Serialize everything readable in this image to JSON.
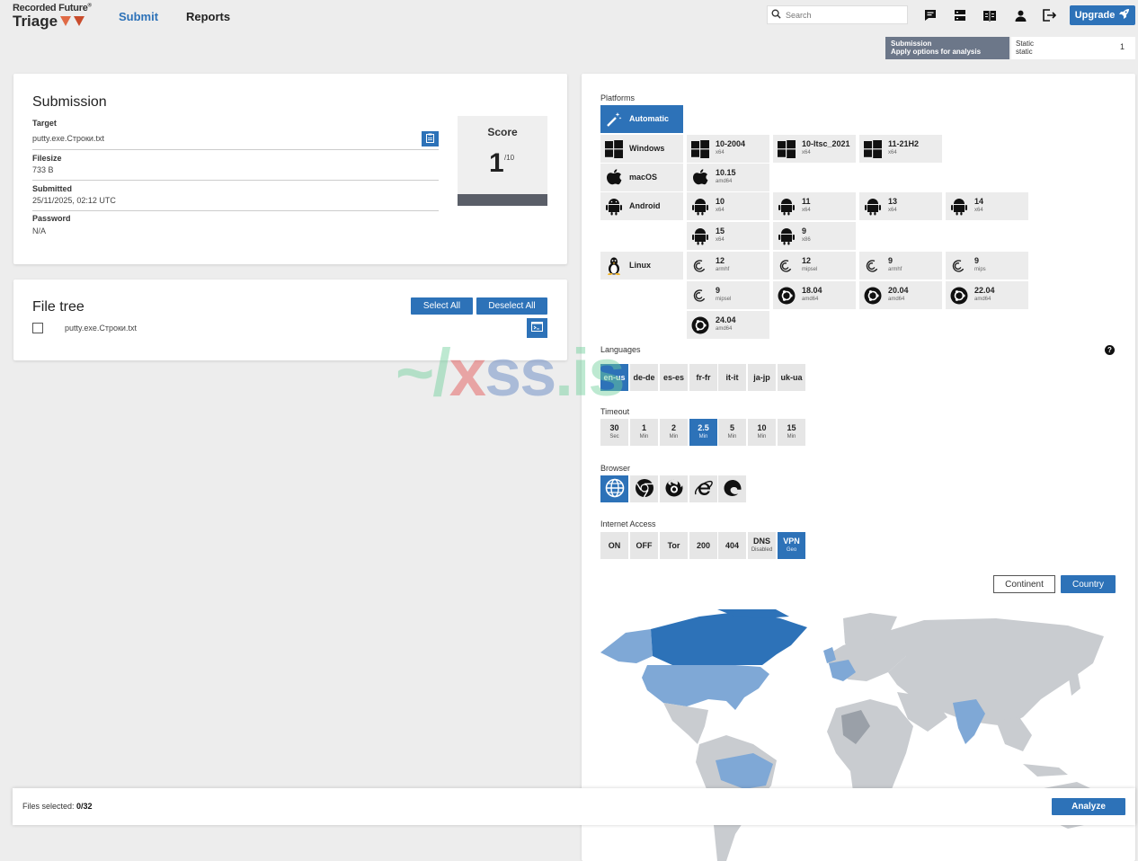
{
  "brand": {
    "company": "Recorded Future",
    "product": "Triage"
  },
  "nav": {
    "submit": "Submit",
    "reports": "Reports"
  },
  "search": {
    "placeholder": "Search"
  },
  "upgrade": {
    "label": "Upgrade"
  },
  "badge": {
    "line1": "Submission",
    "line2": "Apply options for analysis"
  },
  "static_box": {
    "line1": "Static",
    "line2": "static",
    "count": "1"
  },
  "submission": {
    "title": "Submission",
    "target_label": "Target",
    "target": "putty.exe.Строки.txt",
    "filesize_label": "Filesize",
    "filesize": "733 B",
    "submitted_label": "Submitted",
    "submitted": "25/11/2025, 02:12 UTC",
    "password_label": "Password",
    "password": "N/A",
    "score_label": "Score",
    "score": "1",
    "score_max": "/10"
  },
  "file_tree": {
    "title": "File tree",
    "select_all": "Select All",
    "deselect_all": "Deselect All",
    "file": "putty.exe.Строки.txt"
  },
  "platforms": {
    "label": "Platforms",
    "automatic": "Automatic",
    "windows": {
      "name": "Windows",
      "versions": [
        {
          "name": "10-2004",
          "arch": "x64"
        },
        {
          "name": "10-ltsc_2021",
          "arch": "x64"
        },
        {
          "name": "11-21H2",
          "arch": "x64"
        }
      ]
    },
    "macos": {
      "name": "macOS",
      "versions": [
        {
          "name": "10.15",
          "arch": "amd64"
        }
      ]
    },
    "android": {
      "name": "Android",
      "versions": [
        {
          "name": "10",
          "arch": "x64"
        },
        {
          "name": "11",
          "arch": "x64"
        },
        {
          "name": "13",
          "arch": "x64"
        },
        {
          "name": "14",
          "arch": "x64"
        },
        {
          "name": "15",
          "arch": "x64"
        },
        {
          "name": "9",
          "arch": "x86"
        }
      ]
    },
    "linux": {
      "name": "Linux",
      "versions": [
        {
          "name": "12",
          "arch": "armhf"
        },
        {
          "name": "12",
          "arch": "mipsel"
        },
        {
          "name": "9",
          "arch": "armhf"
        },
        {
          "name": "9",
          "arch": "mips"
        },
        {
          "name": "9",
          "arch": "mipsel"
        },
        {
          "name": "18.04",
          "arch": "amd64"
        },
        {
          "name": "20.04",
          "arch": "amd64"
        },
        {
          "name": "22.04",
          "arch": "amd64"
        },
        {
          "name": "24.04",
          "arch": "amd64"
        }
      ]
    }
  },
  "languages": {
    "label": "Languages",
    "options": [
      "en-us",
      "de-de",
      "es-es",
      "fr-fr",
      "it-it",
      "ja-jp",
      "uk-ua"
    ],
    "selected": "en-us"
  },
  "timeout": {
    "label": "Timeout",
    "options": [
      {
        "v": "30",
        "u": "Sec"
      },
      {
        "v": "1",
        "u": "Min"
      },
      {
        "v": "2",
        "u": "Min"
      },
      {
        "v": "2.5",
        "u": "Min"
      },
      {
        "v": "5",
        "u": "Min"
      },
      {
        "v": "10",
        "u": "Min"
      },
      {
        "v": "15",
        "u": "Min"
      }
    ],
    "selected": "2.5"
  },
  "browser": {
    "label": "Browser",
    "options": [
      "default-browser-icon",
      "chrome-icon",
      "firefox-icon",
      "ie-icon",
      "edge-icon"
    ],
    "selected": "default-browser-icon"
  },
  "internet": {
    "label": "Internet Access",
    "options": [
      {
        "v": "ON",
        "u": ""
      },
      {
        "v": "OFF",
        "u": ""
      },
      {
        "v": "Tor",
        "u": ""
      },
      {
        "v": "200",
        "u": ""
      },
      {
        "v": "404",
        "u": ""
      },
      {
        "v": "DNS",
        "u": "Disabled"
      },
      {
        "v": "VPN",
        "u": "Geo"
      }
    ],
    "selected": "VPN"
  },
  "geo": {
    "continent": "Continent",
    "country": "Country",
    "selected": "Country"
  },
  "footer": {
    "files_label": "Files selected:",
    "files_value": "0/32",
    "analyze": "Analyze"
  },
  "watermark": {
    "a": "~/",
    "b": "x",
    "c": "ss",
    "d": ".is"
  },
  "colors": {
    "accent": "#2d72b8",
    "map_selected": "#2d72b8",
    "map_partial": "#7fa8d6",
    "map_other": "#c9ccd0"
  }
}
